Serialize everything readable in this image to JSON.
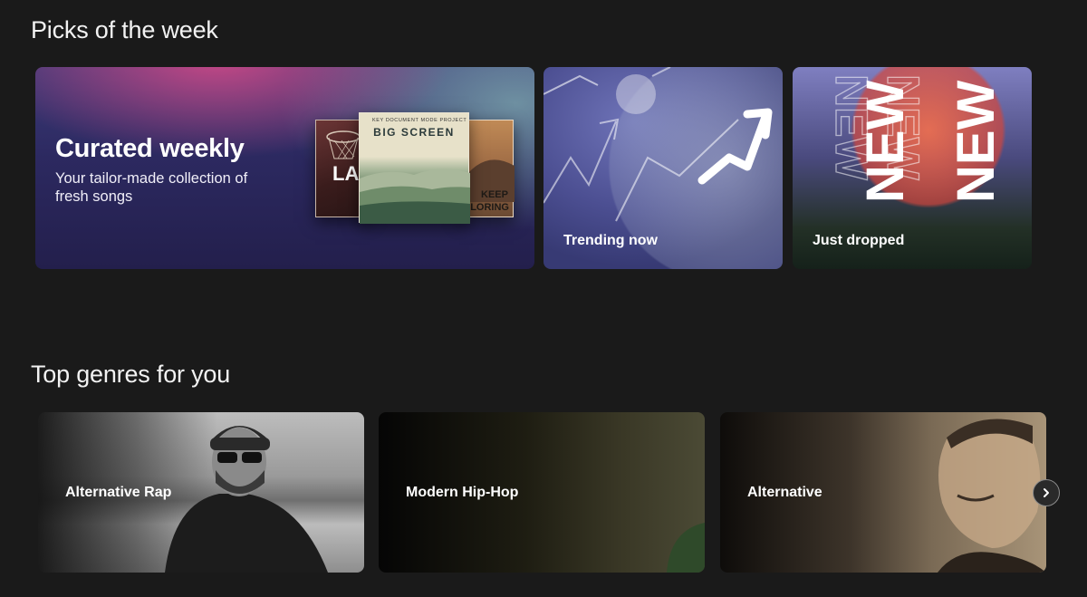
{
  "sections": {
    "picks_title": "Picks of the week",
    "genres_title": "Top genres for you"
  },
  "picks": {
    "curated": {
      "title": "Curated weekly",
      "subtitle": "Your tailor-made collection of fresh songs",
      "albums": {
        "left_text": "LA",
        "center_band": "KEY DOCUMENT MODE PROJECT",
        "center_name": "BIG SCREEN",
        "right_line1": "KEEP",
        "right_line2": "PLORING"
      }
    },
    "trending": {
      "label": "Trending now"
    },
    "just_dropped": {
      "label": "Just dropped",
      "art_word": "NEW"
    }
  },
  "genres": [
    {
      "label": "Alternative Rap"
    },
    {
      "label": "Modern Hip-Hop"
    },
    {
      "label": "Alternative"
    }
  ],
  "carousel": {
    "next_icon": "chevron-right-icon"
  },
  "colors": {
    "background": "#1a1a1a",
    "text": "#ffffff"
  }
}
